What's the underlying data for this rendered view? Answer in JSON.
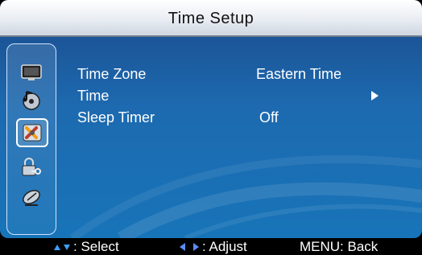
{
  "window": {
    "title": "Time Setup"
  },
  "sidebar": {
    "items": [
      {
        "icon": "tv-picture-icon",
        "selected": false
      },
      {
        "icon": "audio-cd-icon",
        "selected": false
      },
      {
        "icon": "setup-tools-icon",
        "selected": true
      },
      {
        "icon": "lock-key-icon",
        "selected": false
      },
      {
        "icon": "satellite-dish-icon",
        "selected": false
      }
    ]
  },
  "menu": {
    "items": [
      {
        "label": "Time Zone",
        "value": "Eastern Time"
      },
      {
        "label": "Time",
        "value": ""
      },
      {
        "label": "Sleep Timer",
        "value": "Off"
      }
    ]
  },
  "footer": {
    "select_label": ": Select",
    "adjust_label": ": Adjust",
    "back_label": "MENU: Back"
  },
  "colors": {
    "accent": "#1d6ab0",
    "arrow_up_down": "#3aa0ff",
    "arrow_left_right": "#5a8cff"
  }
}
